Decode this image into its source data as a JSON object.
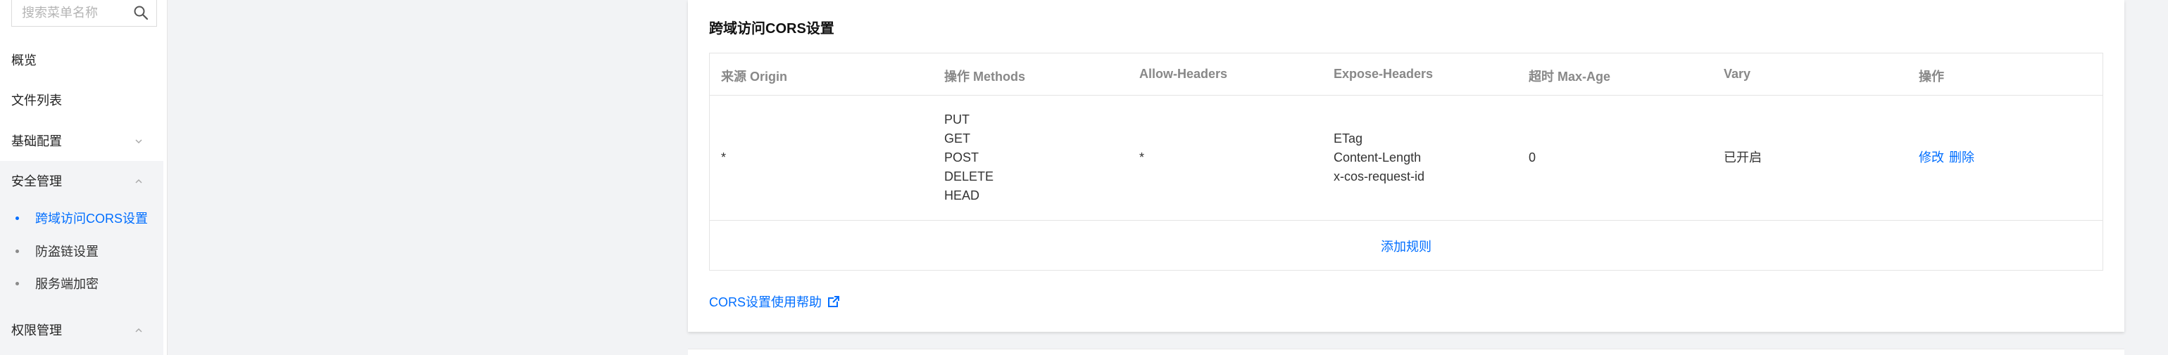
{
  "sidebar": {
    "search": {
      "placeholder": "搜索菜单名称",
      "value": ""
    },
    "items": [
      {
        "label": "概览"
      },
      {
        "label": "文件列表"
      },
      {
        "label": "基础配置"
      },
      {
        "label": "安全管理"
      },
      {
        "label": "权限管理"
      }
    ],
    "security_sub": [
      {
        "label": "跨域访问CORS设置",
        "active": true
      },
      {
        "label": "防盗链设置",
        "active": false
      },
      {
        "label": "服务端加密",
        "active": false
      }
    ]
  },
  "card": {
    "title": "跨域访问CORS设置",
    "columns": [
      "来源 Origin",
      "操作 Methods",
      "Allow-Headers",
      "Expose-Headers",
      "超时 Max-Age",
      "Vary",
      "操作"
    ],
    "rows": [
      {
        "origin": "*",
        "methods": [
          "PUT",
          "GET",
          "POST",
          "DELETE",
          "HEAD"
        ],
        "allow_headers": "*",
        "expose_headers": [
          "ETag",
          "Content-Length",
          "x-cos-request-id"
        ],
        "max_age": "0",
        "vary": "已开启",
        "actions": {
          "edit": "修改",
          "delete": "删除"
        }
      }
    ],
    "add_rule": "添加规则",
    "help_link": "CORS设置使用帮助"
  },
  "colors": {
    "accent": "#006eff",
    "sidebar_group_bg": "#f3f4f6",
    "page_bg": "#f2f3f5"
  }
}
